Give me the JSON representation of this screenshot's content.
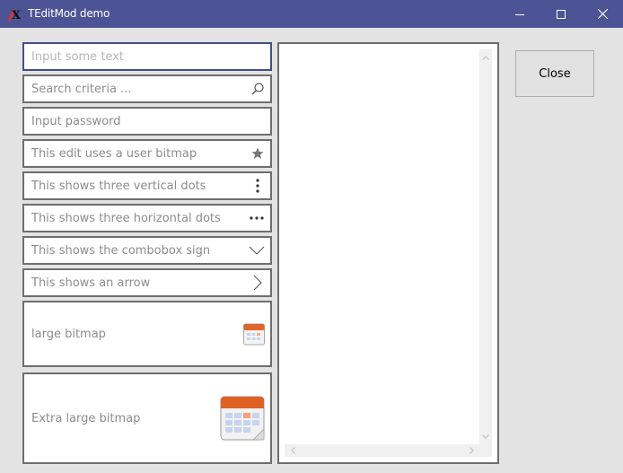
{
  "window": {
    "title": "TEditMod demo"
  },
  "edits": [
    {
      "text": "Input some text",
      "placeholder": true,
      "button_icon": "none"
    },
    {
      "text": "Search criteria ...",
      "placeholder": false,
      "button_icon": "magnifier-icon"
    },
    {
      "text": "Input password",
      "placeholder": false,
      "button_icon": "none"
    },
    {
      "text": "This edit uses a user bitmap",
      "placeholder": false,
      "button_icon": "star-icon"
    },
    {
      "text": "This shows three vertical dots",
      "placeholder": false,
      "button_icon": "vertical-dots-icon"
    },
    {
      "text": "This shows three horizontal dots",
      "placeholder": false,
      "button_icon": "horizontal-dots-icon"
    },
    {
      "text": "This shows the combobox sign",
      "placeholder": false,
      "button_icon": "combobox-chevron-icon"
    },
    {
      "text": "This shows an arrow",
      "placeholder": false,
      "button_icon": "arrow-right-icon"
    },
    {
      "text": "large bitmap",
      "placeholder": false,
      "button_icon": "calendar-icon"
    },
    {
      "text": "Extra large bitmap",
      "placeholder": false,
      "button_icon": "calendar-large-icon"
    }
  ],
  "close_button": {
    "label": "Close"
  },
  "colors": {
    "titlebar": "#4d5496",
    "background": "#e3e3e3",
    "focus_border": "#454e8a",
    "border": "#6e6e6e"
  }
}
